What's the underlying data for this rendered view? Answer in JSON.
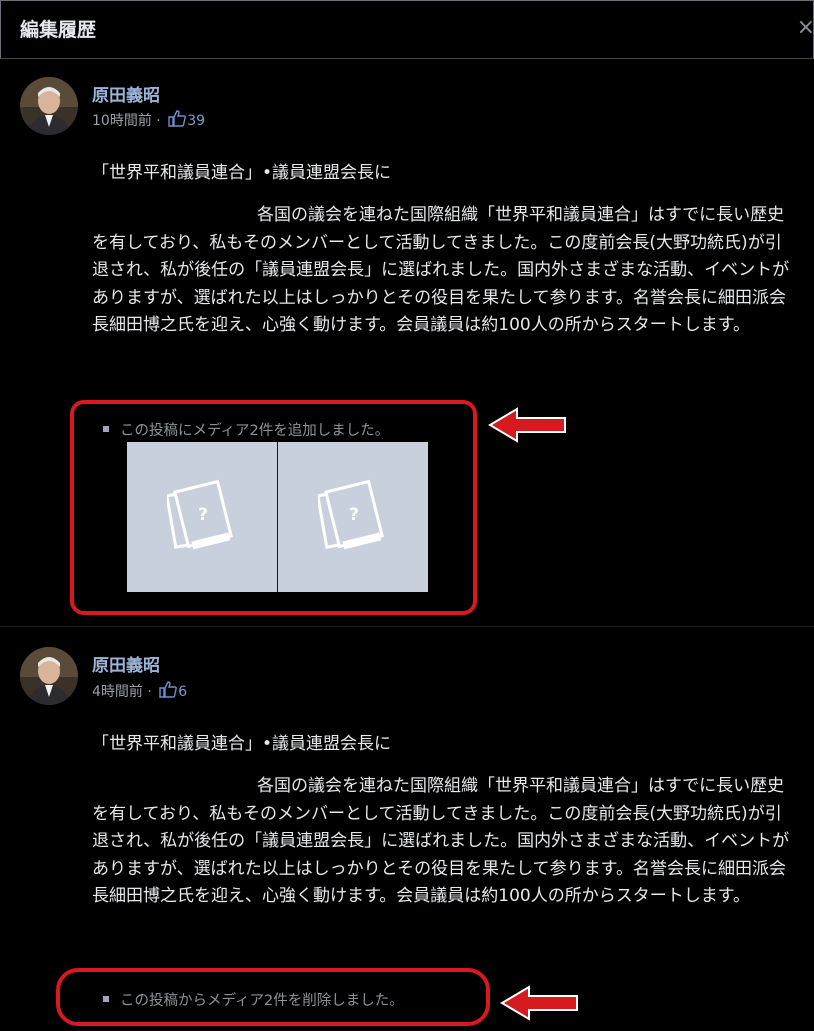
{
  "dialog": {
    "title": "編集履歴",
    "close": "×"
  },
  "entries": [
    {
      "author": "原田義昭",
      "time": "10時間前",
      "separator": "·",
      "likes": "39",
      "title": "「世界平和議員連合」•議員連盟会長に",
      "body": "各国の議会を連ねた国際組織「世界平和議員連合」はすでに長い歴史を有しており、私もそのメンバーとして活動してきました。この度前会長(大野功統氏)が引退され、私が後任の「議員連盟会長」に選ばれました。国内外さまざまな活動、イベントがありますが、選ばれた以上はしっかりとその役目を果たして参ります。名誉会長に細田派会長細田博之氏を迎え、心強く動けます。会員議員は約100人の所からスタートします。",
      "change": "この投稿にメディア2件を追加しました。",
      "media": [
        {
          "icon": "photo-placeholder-icon",
          "mark": "?"
        },
        {
          "icon": "photo-placeholder-icon",
          "mark": "?"
        }
      ]
    },
    {
      "author": "原田義昭",
      "time": "4時間前",
      "separator": "·",
      "likes": "6",
      "title": "「世界平和議員連合」•議員連盟会長に",
      "body": "各国の議会を連ねた国際組織「世界平和議員連合」はすでに長い歴史を有しており、私もそのメンバーとして活動してきました。この度前会長(大野功統氏)が引退され、私が後任の「議員連盟会長」に選ばれました。国内外さまざまな活動、イベントがありますが、選ばれた以上はしっかりとその役目を果たして参ります。名誉会長に細田派会長細田博之氏を迎え、心強く動けます。会員議員は約100人の所からスタートします。",
      "change": "この投稿からメディア2件を削除しました。"
    }
  ],
  "colors": {
    "annotation_red": "#d71920",
    "author_blue": "#9cb4d8",
    "placeholder_bg": "#c9d0dd"
  }
}
